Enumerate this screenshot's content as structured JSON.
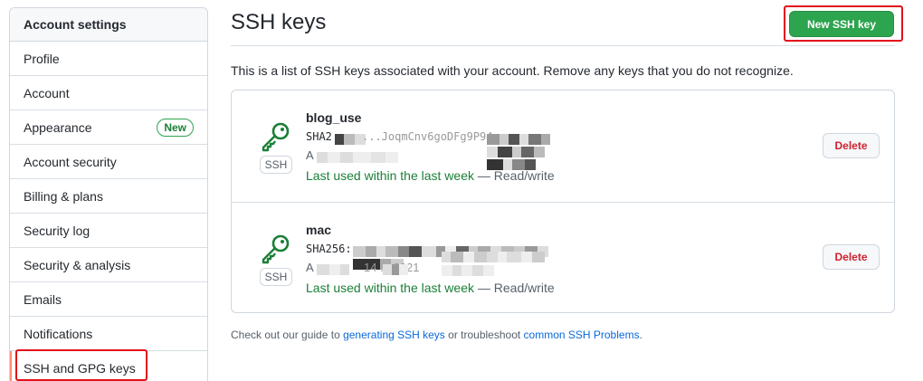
{
  "sidebar": {
    "header": "Account settings",
    "items": [
      {
        "label": "Profile"
      },
      {
        "label": "Account"
      },
      {
        "label": "Appearance",
        "badge": "New"
      },
      {
        "label": "Account security"
      },
      {
        "label": "Billing & plans"
      },
      {
        "label": "Security log"
      },
      {
        "label": "Security & analysis"
      },
      {
        "label": "Emails"
      },
      {
        "label": "Notifications"
      },
      {
        "label": "SSH and GPG keys",
        "selected": true
      }
    ]
  },
  "main": {
    "title": "SSH keys",
    "new_button": "New SSH key",
    "intro": "This is a list of SSH keys associated with your account. Remove any keys that you do not recognize.",
    "keys": [
      {
        "name": "blog_use",
        "fingerprint": "SHA2",
        "fingerprint_mid": "...JoqmCnv6goDFg9P94",
        "added": "A",
        "last_used": "Last used within the last week",
        "access": "— Read/write",
        "type_label": "SSH",
        "delete_label": "Delete"
      },
      {
        "name": "mac",
        "fingerprint": "SHA256:",
        "fingerprint_mid": "",
        "added": "A",
        "added_tail": "14 ... 2021",
        "last_used": "Last used within the last week",
        "access": "— Read/write",
        "type_label": "SSH",
        "delete_label": "Delete"
      }
    ],
    "footer": {
      "prefix": "Check out our guide to ",
      "link1": "generating SSH keys",
      "middle": " or troubleshoot ",
      "link2": "common SSH Problems",
      "suffix": "."
    }
  },
  "colors": {
    "primary_button": "#2da44e",
    "success_text": "#1a7f37",
    "danger_text": "#cf222e",
    "link": "#0969da",
    "annotation_red": "#e3101a"
  }
}
